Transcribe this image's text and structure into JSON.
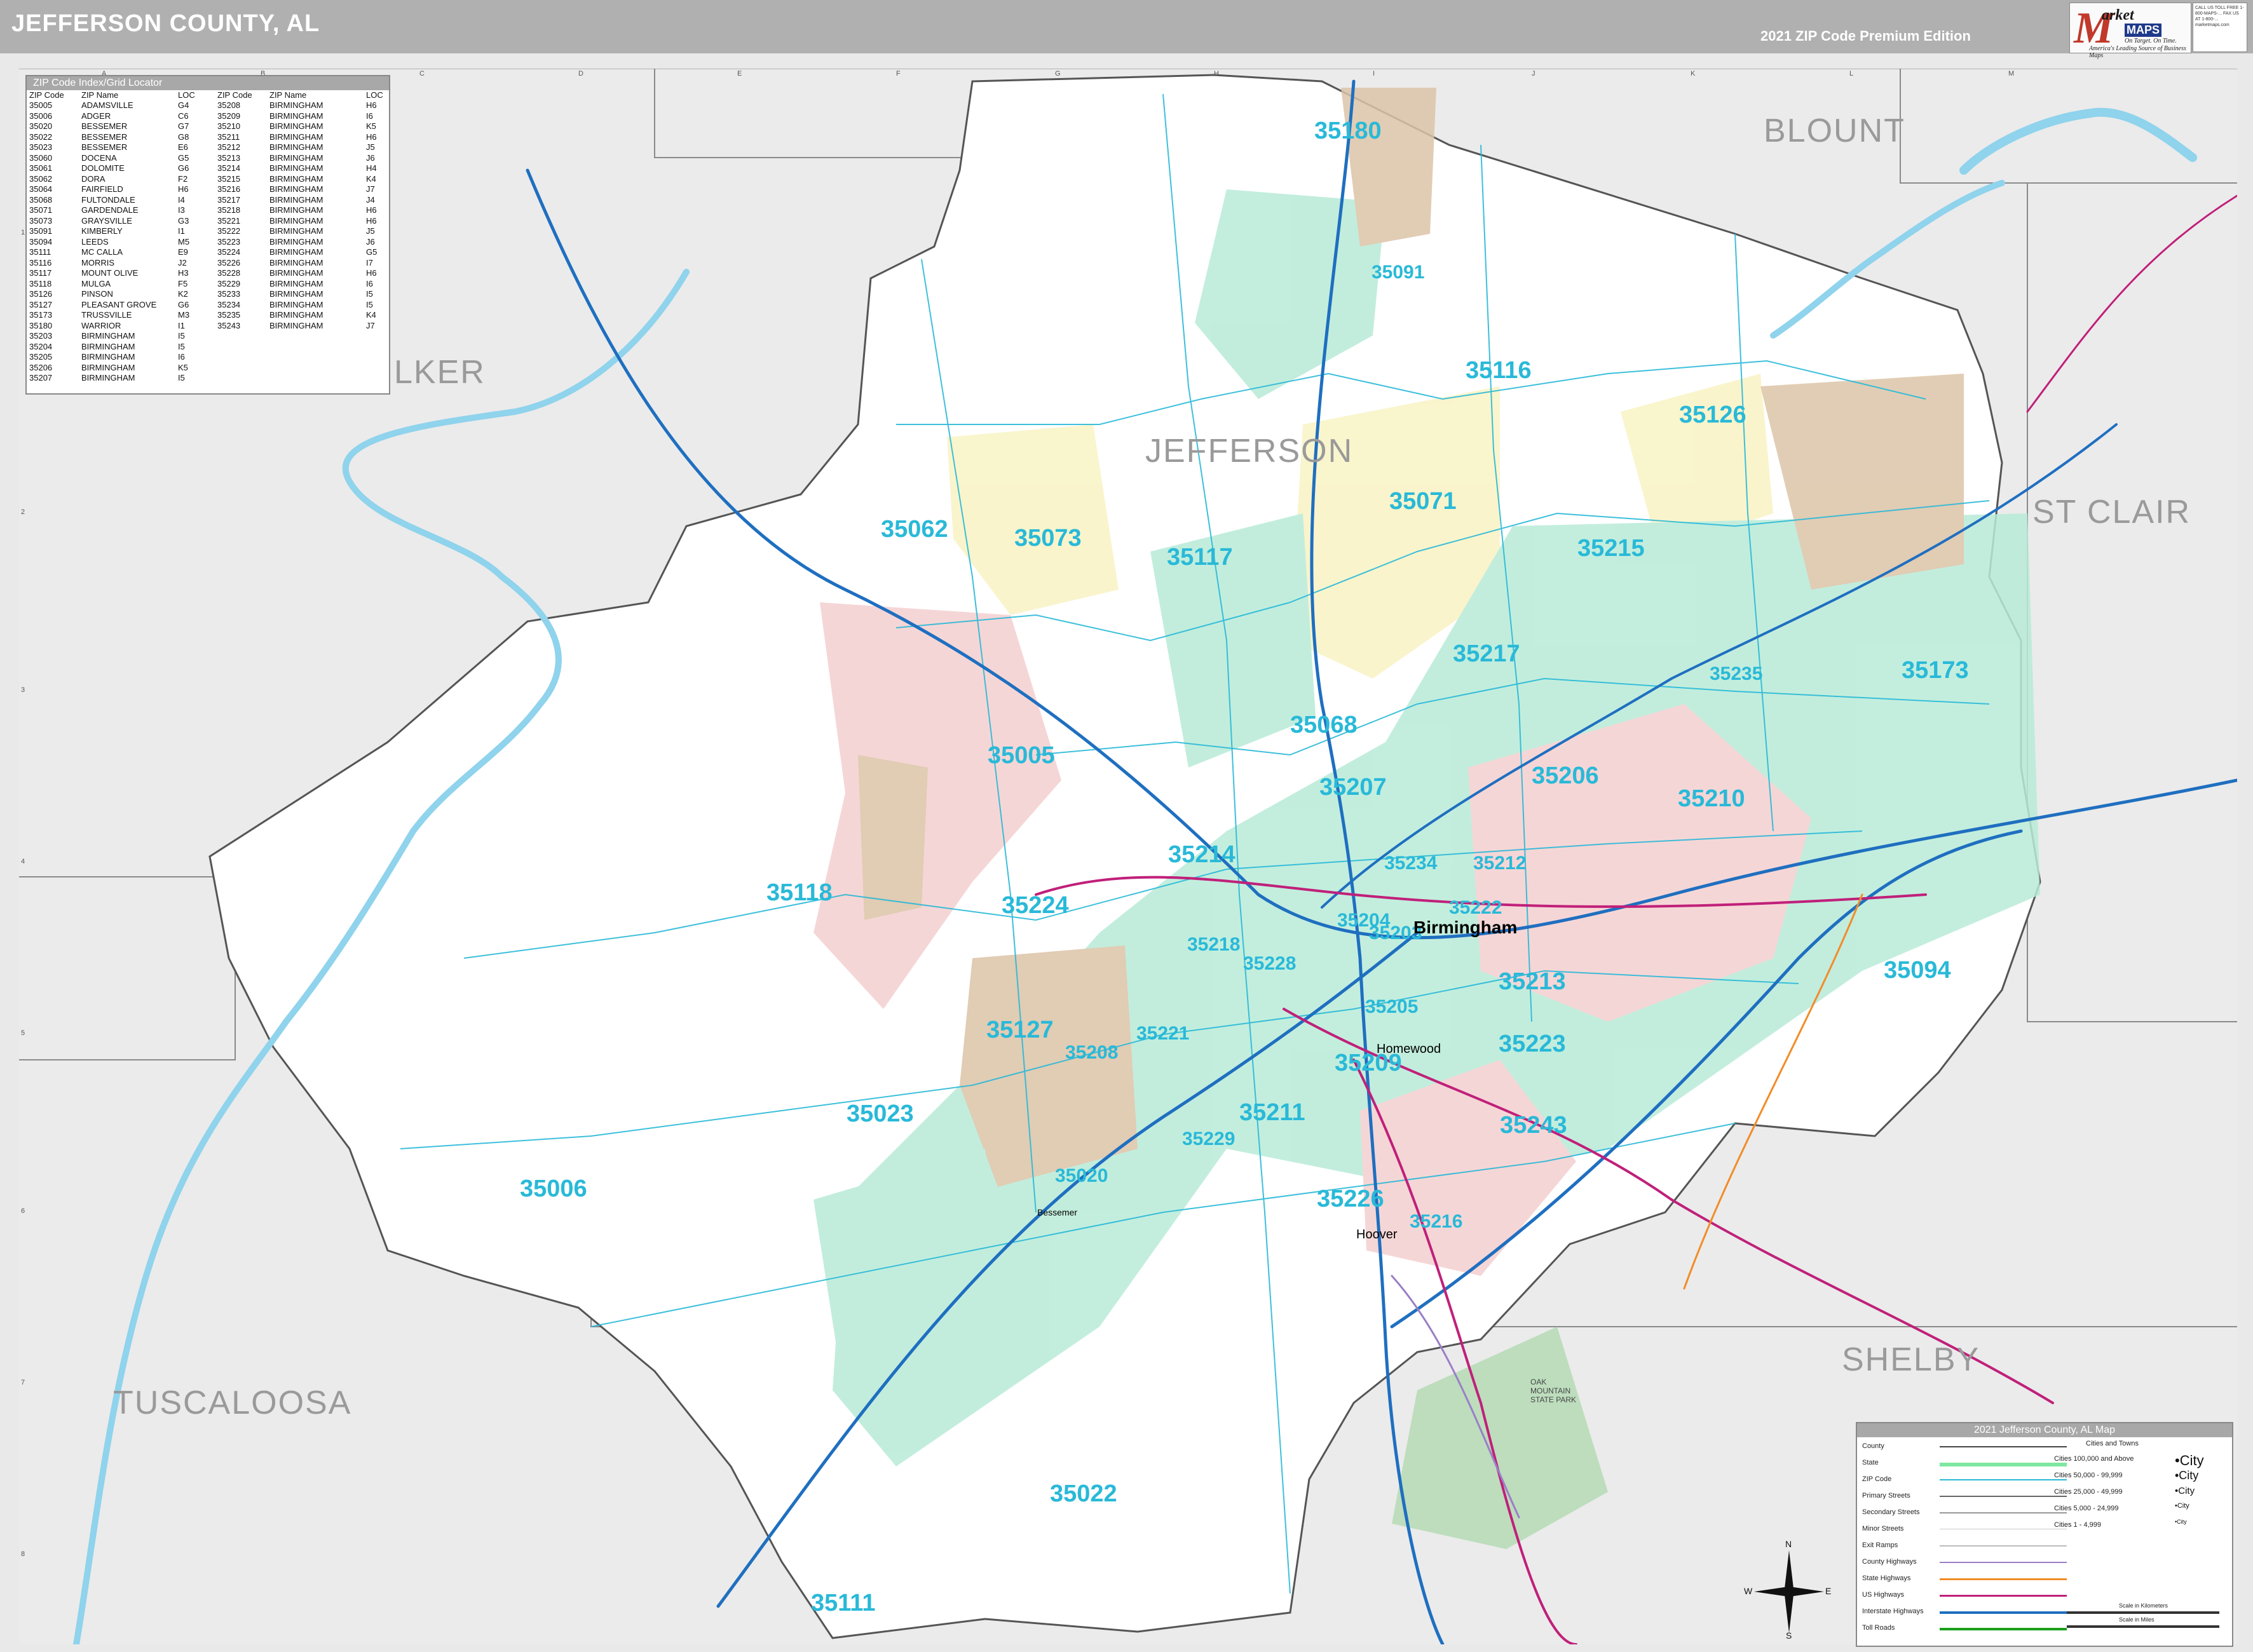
{
  "header": {
    "title": "JEFFERSON COUNTY, AL",
    "edition": "2021 ZIP Code Premium Edition",
    "brand_market": "arket",
    "brand_maps": "MAPS",
    "brand_tagline1": "On Target. On Time.",
    "brand_tagline2": "America's Leading Source of Business Maps",
    "contact": "CALL US TOLL FREE 1-800-MAPS-... FAX US AT 1-800-... marketmaps.com"
  },
  "zip_index": {
    "title": "ZIP Code Index/Grid Locator",
    "headers": [
      "ZIP Code",
      "ZIP Name",
      "LOC",
      "ZIP Code",
      "ZIP Name",
      "LOC"
    ],
    "left": [
      [
        "35005",
        "ADAMSVILLE",
        "G4"
      ],
      [
        "35006",
        "ADGER",
        "C6"
      ],
      [
        "35020",
        "BESSEMER",
        "G7"
      ],
      [
        "35022",
        "BESSEMER",
        "G8"
      ],
      [
        "35023",
        "BESSEMER",
        "E6"
      ],
      [
        "35060",
        "DOCENA",
        "G5"
      ],
      [
        "35061",
        "DOLOMITE",
        "G6"
      ],
      [
        "35062",
        "DORA",
        "F2"
      ],
      [
        "35064",
        "FAIRFIELD",
        "H6"
      ],
      [
        "35068",
        "FULTONDALE",
        "I4"
      ],
      [
        "35071",
        "GARDENDALE",
        "I3"
      ],
      [
        "35073",
        "GRAYSVILLE",
        "G3"
      ],
      [
        "35091",
        "KIMBERLY",
        "I1"
      ],
      [
        "35094",
        "LEEDS",
        "M5"
      ],
      [
        "35111",
        "MC CALLA",
        "E9"
      ],
      [
        "35116",
        "MORRIS",
        "J2"
      ],
      [
        "35117",
        "MOUNT OLIVE",
        "H3"
      ],
      [
        "35118",
        "MULGA",
        "F5"
      ],
      [
        "35126",
        "PINSON",
        "K2"
      ],
      [
        "35127",
        "PLEASANT GROVE",
        "G6"
      ],
      [
        "35173",
        "TRUSSVILLE",
        "M3"
      ],
      [
        "35180",
        "WARRIOR",
        "I1"
      ],
      [
        "35203",
        "BIRMINGHAM",
        "I5"
      ],
      [
        "35204",
        "BIRMINGHAM",
        "I5"
      ],
      [
        "35205",
        "BIRMINGHAM",
        "I6"
      ],
      [
        "35206",
        "BIRMINGHAM",
        "K5"
      ],
      [
        "35207",
        "BIRMINGHAM",
        "I5"
      ]
    ],
    "right": [
      [
        "35208",
        "BIRMINGHAM",
        "H6"
      ],
      [
        "35209",
        "BIRMINGHAM",
        "I6"
      ],
      [
        "35210",
        "BIRMINGHAM",
        "K5"
      ],
      [
        "35211",
        "BIRMINGHAM",
        "H6"
      ],
      [
        "35212",
        "BIRMINGHAM",
        "J5"
      ],
      [
        "35213",
        "BIRMINGHAM",
        "J6"
      ],
      [
        "35214",
        "BIRMINGHAM",
        "H4"
      ],
      [
        "35215",
        "BIRMINGHAM",
        "K4"
      ],
      [
        "35216",
        "BIRMINGHAM",
        "J7"
      ],
      [
        "35217",
        "BIRMINGHAM",
        "J4"
      ],
      [
        "35218",
        "BIRMINGHAM",
        "H6"
      ],
      [
        "35221",
        "BIRMINGHAM",
        "H6"
      ],
      [
        "35222",
        "BIRMINGHAM",
        "J5"
      ],
      [
        "35223",
        "BIRMINGHAM",
        "J6"
      ],
      [
        "35224",
        "BIRMINGHAM",
        "G5"
      ],
      [
        "35226",
        "BIRMINGHAM",
        "I7"
      ],
      [
        "35228",
        "BIRMINGHAM",
        "H6"
      ],
      [
        "35229",
        "BIRMINGHAM",
        "I6"
      ],
      [
        "35233",
        "BIRMINGHAM",
        "I5"
      ],
      [
        "35234",
        "BIRMINGHAM",
        "I5"
      ],
      [
        "35235",
        "BIRMINGHAM",
        "K4"
      ],
      [
        "35243",
        "BIRMINGHAM",
        "J7"
      ]
    ]
  },
  "grid": {
    "cols": [
      "A",
      "B",
      "C",
      "D",
      "E",
      "F",
      "G",
      "H",
      "I",
      "J",
      "K",
      "L",
      "M"
    ],
    "rows": [
      "1",
      "2",
      "3",
      "4",
      "5",
      "6",
      "7",
      "8",
      "9"
    ]
  },
  "counties": {
    "jefferson": "JEFFERSON",
    "blount": "BLOUNT",
    "st_clair": "ST CLAIR",
    "walker": "LKER",
    "tuscaloosa": "TUSCALOOSA",
    "shelby": "SHELBY"
  },
  "zips": {
    "z35180": "35180",
    "z35091": "35091",
    "z35116": "35116",
    "z35126": "35126",
    "z35071": "35071",
    "z35062": "35062",
    "z35073": "35073",
    "z35117": "35117",
    "z35215": "35215",
    "z35217": "35217",
    "z35235": "35235",
    "z35173": "35173",
    "z35068": "35068",
    "z35005": "35005",
    "z35207": "35207",
    "z35206": "35206",
    "z35210": "35210",
    "z35214": "35214",
    "z35234": "35234",
    "z35212": "35212",
    "z35222": "35222",
    "z35118": "35118",
    "z35224": "35224",
    "z35204": "35204",
    "z35203": "35203",
    "z35218": "35218",
    "z35228": "35228",
    "z35213": "35213",
    "z35094": "35094",
    "z35205": "35205",
    "z35127": "35127",
    "z35221": "35221",
    "z35208": "35208",
    "z35223": "35223",
    "z35209": "35209",
    "z35023": "35023",
    "z35211": "35211",
    "z35243": "35243",
    "z35229": "35229",
    "z35006": "35006",
    "z35020": "35020",
    "z35226": "35226",
    "z35216": "35216",
    "z35022": "35022",
    "z35111": "35111"
  },
  "cities": {
    "birmingham": "Birmingham",
    "hoover": "Hoover",
    "homewood": "Homewood",
    "bessemer": "Bessemer"
  },
  "park": "OAK MOUNTAIN STATE PARK",
  "legend": {
    "title": "2021 Jefferson County, AL Map",
    "items": [
      "County",
      "State",
      "ZIP Code",
      "Primary Streets",
      "Secondary Streets",
      "Minor Streets",
      "Exit Ramps",
      "County Highways",
      "State Highways",
      "US Highways",
      "Interstate Highways",
      "Toll Roads"
    ],
    "cities_header": "Cities and Towns",
    "cities": [
      "Cities 100,000 and Above",
      "Cities 50,000 - 99,999",
      "Cities 25,000 - 49,999",
      "Cities 5,000 - 24,999",
      "Cities 1 - 4,999"
    ],
    "city_samples": [
      "City",
      "City",
      "City",
      "City",
      "City"
    ],
    "scale_km": "Scale in Kilometers",
    "scale_mi": "Scale in Miles",
    "colors": {
      "zip_line": "#29b9d8",
      "interstate": "#1f6fc0",
      "us_hwy": "#c0207a",
      "state_hwy": "#f28c28",
      "county_hwy": "#9a7fc6",
      "toll": "#1aa01a",
      "water": "#8fd3ec",
      "zip_green": "#b8ebd8",
      "zip_pink": "#f4cfcf",
      "zip_tan": "#dcc4a8",
      "zip_yellow": "#f8f3c4",
      "park": "#b5dbb5"
    }
  },
  "compass": {
    "n": "N",
    "s": "S",
    "e": "E",
    "w": "W"
  }
}
